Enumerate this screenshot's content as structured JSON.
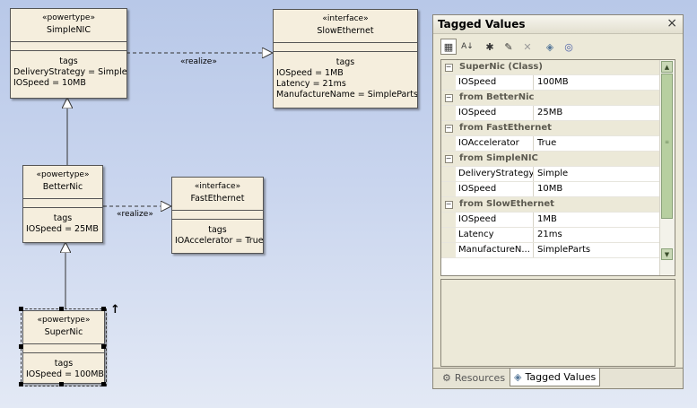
{
  "diagram": {
    "classes": {
      "simplenic": {
        "stereotype": "«powertype»",
        "name": "SimpleNIC",
        "tags_label": "tags",
        "values": [
          "DeliveryStrategy = Simple",
          "IOSpeed = 10MB"
        ]
      },
      "slowethernet": {
        "stereotype": "«interface»",
        "name": "SlowEthernet",
        "tags_label": "tags",
        "values": [
          "IOSpeed = 1MB",
          "Latency = 21ms",
          "ManufactureName = SimpleParts"
        ]
      },
      "betternic": {
        "stereotype": "«powertype»",
        "name": "BetterNic",
        "tags_label": "tags",
        "values": [
          "IOSpeed = 25MB"
        ]
      },
      "fastethernet": {
        "stereotype": "«interface»",
        "name": "FastEthernet",
        "tags_label": "tags",
        "values": [
          "IOAccelerator = True"
        ]
      },
      "supernic": {
        "stereotype": "«powertype»",
        "name": "SuperNic",
        "tags_label": "tags",
        "values": [
          "IOSpeed = 100MB"
        ]
      }
    },
    "realize_label_1": "«realize»",
    "realize_label_2": "«realize»",
    "resize_arrow": "↑"
  },
  "panel": {
    "title": "Tagged Values",
    "close": "×",
    "toolbar_icons": [
      "categorized-icon",
      "alphabetic-icon",
      "new-tag-icon",
      "edit-notes-icon",
      "delete-icon",
      "tag-icon",
      "help-icon"
    ],
    "toolbar_glyphs": [
      "▦",
      "A↓",
      "✱",
      "✎",
      "✕",
      "◈",
      "◎"
    ],
    "groups": [
      {
        "title": "SuperNic (Class)",
        "rows": [
          {
            "name": "IOSpeed",
            "value": "100MB"
          }
        ]
      },
      {
        "title": "from BetterNic",
        "rows": [
          {
            "name": "IOSpeed",
            "value": "25MB"
          }
        ]
      },
      {
        "title": "from FastEthernet",
        "rows": [
          {
            "name": "IOAccelerator",
            "value": "True"
          }
        ]
      },
      {
        "title": "from SimpleNIC",
        "rows": [
          {
            "name": "DeliveryStrategy",
            "value": "Simple"
          },
          {
            "name": "IOSpeed",
            "value": "10MB"
          }
        ]
      },
      {
        "title": "from SlowEthernet",
        "rows": [
          {
            "name": "IOSpeed",
            "value": "1MB"
          },
          {
            "name": "Latency",
            "value": "21ms"
          },
          {
            "name": "ManufactureN...",
            "value": "SimpleParts"
          }
        ]
      }
    ],
    "tabs": [
      {
        "label": "Resources",
        "selected": false,
        "icon": "resources-icon",
        "glyph": "⚙"
      },
      {
        "label": "Tagged Values",
        "selected": true,
        "icon": "tagged-values-icon",
        "glyph": "◈"
      }
    ],
    "colors": {
      "group_bg": "#ece9d8",
      "scroll_accent": "#b7cfa0"
    }
  }
}
